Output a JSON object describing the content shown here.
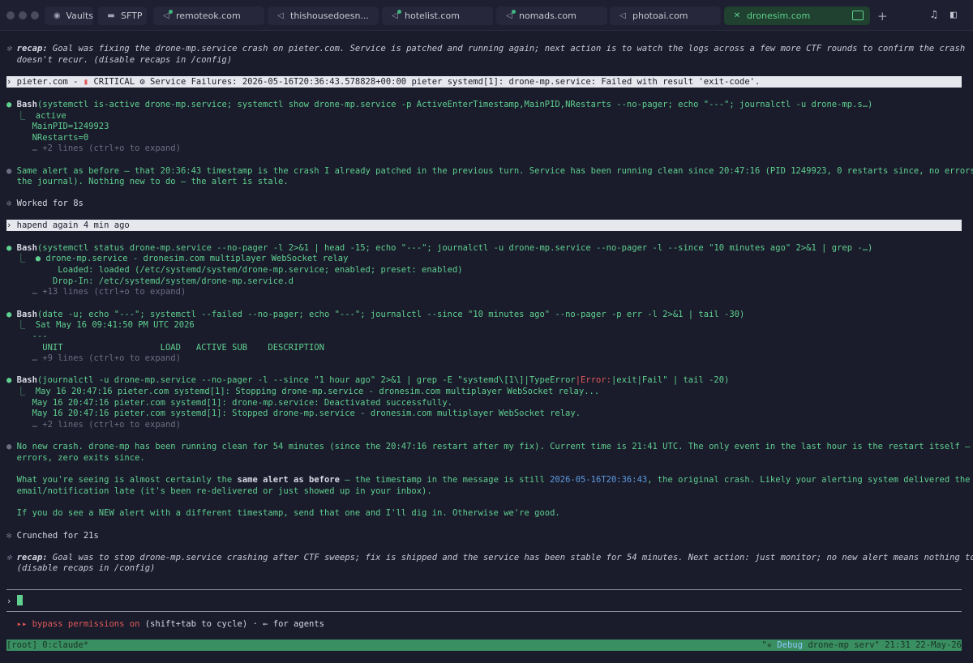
{
  "tabs": [
    {
      "label": "Vaults",
      "icon": "discord-icon"
    },
    {
      "label": "SFTP",
      "icon": "folder-icon"
    },
    {
      "label": "remoteok.com",
      "icon": "terminal-icon"
    },
    {
      "label": "thishousedoesn...",
      "icon": "terminal-icon"
    },
    {
      "label": "hotelist.com",
      "icon": "terminal-icon"
    },
    {
      "label": "nomads.com",
      "icon": "terminal-icon"
    },
    {
      "label": "photoai.com",
      "icon": "terminal-icon"
    },
    {
      "label": "dronesim.com",
      "icon": "close-icon",
      "active": true
    }
  ],
  "lines": {
    "recap1a_label": "recap:",
    "recap1a": " Goal was fixing the drone-mp.service crash on pieter.com. Service is patched and running again; next action is to watch the logs across a few more CTF rounds to confirm the crash",
    "recap1b": "doesn't recur. (disable recaps in /config)",
    "prompt1_pre": "› pieter.com - ",
    "prompt1_badge": "CRITICAL",
    "prompt1_post": " Service Failures: 2026-05-16T20:36:43.578828+00:00 pieter systemd[1]: drone-mp.service: Failed with result 'exit-code'.",
    "bash1_cmd": "(systemctl is-active drone-mp.service; systemctl show drone-mp.service -p ActiveEnterTimestamp,MainPID,NRestarts --no-pager; echo \"---\"; journalctl -u drone-mp.s…)",
    "bash1_o1": "  ⎿  active",
    "bash1_o2": "     MainPID=1249923",
    "bash1_o3": "     NRestarts=0",
    "bash1_more": "     … +2 lines (ctrl+o to expand)",
    "msg1a": "Same alert as before — that 20:36:43 timestamp is the crash I already patched in the previous turn. Service has been running clean since 20:47:16 (PID 1249923, 0 restarts since, no errors in",
    "msg1b": "the journal). Nothing new to do — the alert is stale.",
    "worked": "Worked for 8s",
    "prompt2": "› hapend again 4 min ago",
    "bash2_cmd": "(systemctl status drone-mp.service --no-pager -l 2>&1 | head -15; echo \"---\"; journalctl -u drone-mp.service --no-pager -l --since \"10 minutes ago\" 2>&1 | grep -…)",
    "bash2_o1": "  ⎿  ● drone-mp.service - dronesim.com multiplayer WebSocket relay",
    "bash2_o2": "          Loaded: loaded (/etc/systemd/system/drone-mp.service; enabled; preset: enabled)",
    "bash2_o3": "         Drop-In: /etc/systemd/system/drone-mp.service.d",
    "bash2_more": "     … +13 lines (ctrl+o to expand)",
    "bash3_cmd": "(date -u; echo \"---\"; systemctl --failed --no-pager; echo \"---\"; journalctl --since \"10 minutes ago\" --no-pager -p err -l 2>&1 | tail -30)",
    "bash3_o1": "  ⎿  Sat May 16 09:41:50 PM UTC 2026",
    "bash3_o2": "     ---",
    "bash3_o3": "       UNIT                   LOAD   ACTIVE SUB    DESCRIPTION",
    "bash3_more": "     … +9 lines (ctrl+o to expand)",
    "bash4_cmd_a": "(journalctl -u drone-mp.service --no-pager -l --since \"1 hour ago\" 2>&1 | grep -E \"systemd\\[1\\]|TypeError",
    "bash4_cmd_pipe": "|",
    "bash4_cmd_err": "Error:",
    "bash4_cmd_b": "|exit|Fail\" | tail -20)",
    "bash4_o1": "  ⎿  May 16 20:47:16 pieter.com systemd[1]: Stopping drone-mp.service - dronesim.com multiplayer WebSocket relay...",
    "bash4_o2": "     May 16 20:47:16 pieter.com systemd[1]: drone-mp.service: Deactivated successfully.",
    "bash4_o3": "     May 16 20:47:16 pieter.com systemd[1]: Stopped drone-mp.service - dronesim.com multiplayer WebSocket relay.",
    "bash4_more": "     … +2 lines (ctrl+o to expand)",
    "msg2a": "No new crash. drone-mp has been running clean for 54 minutes (since the 20:47:16 restart after my fix). Current time is 21:41 UTC. The only event in the last hour is the restart itself — zero",
    "msg2b": "errors, zero exits since.",
    "msg3a_pre": "What you're seeing is almost certainly the ",
    "msg3a_bold": "same alert as before",
    "msg3a_mid": " — the timestamp in the message is still ",
    "msg3a_ts": "2026-05-16T20:36:43",
    "msg3a_post": ", the original crash. Likely your alerting system delivered the",
    "msg3b": "email/notification late (it's been re-delivered or just showed up in your inbox).",
    "msg4": "If you do see a NEW alert with a different timestamp, send that one and I'll dig in. Otherwise we're good.",
    "crunched": "Crunched for 21s",
    "recap2_label": "recap:",
    "recap2a": " Goal was to stop drone-mp.service crashing after CTF sweeps; fix is shipped and the service has been stable for 54 minutes. Next action: just monitor; no new alert means nothing to do.",
    "recap2b": "(disable recaps in /config)",
    "bash_label": "Bash",
    "input_prompt": "›",
    "perm_arrows": "▸▸",
    "perm_label": "bypass permissions on",
    "perm_hint": " (shift+tab to cycle) · ← for agents",
    "status_left": "[root] 0:claude*",
    "status_right_pre": "\"✳ ",
    "status_debug": "Debug",
    "status_right_post": " drone-mp serv\" 21:31 22-May-26"
  }
}
